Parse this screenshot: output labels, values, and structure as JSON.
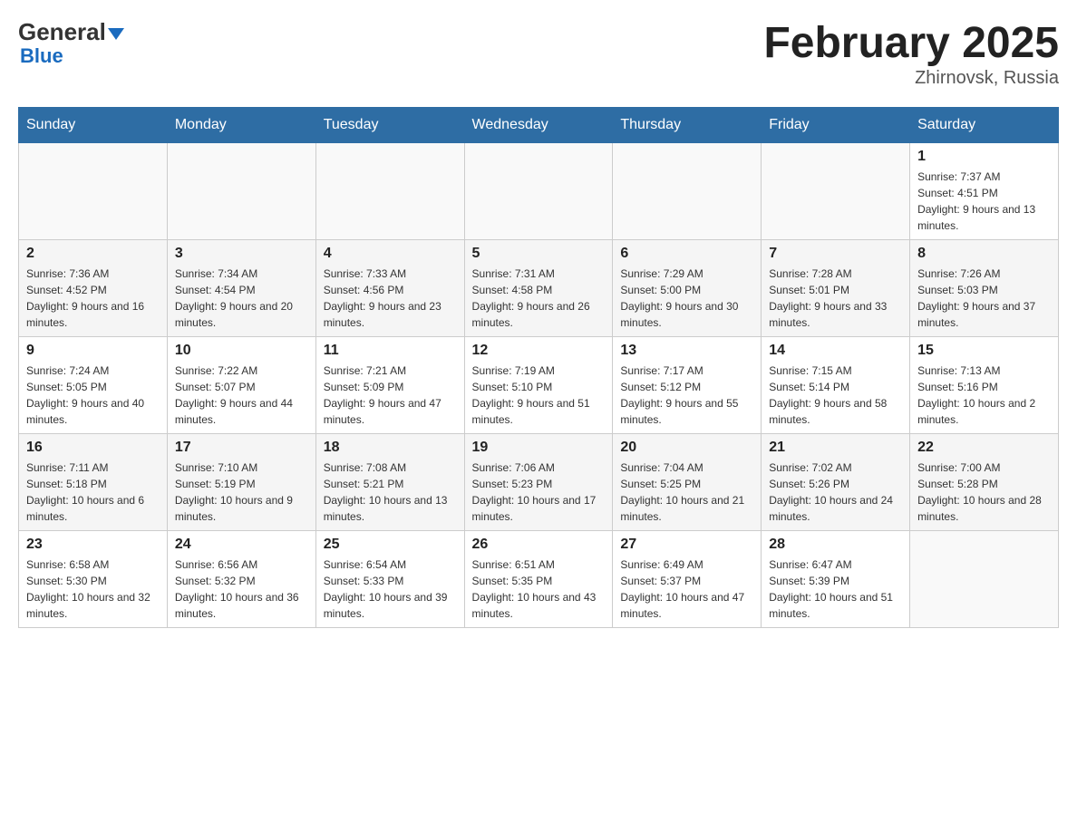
{
  "header": {
    "logo_text": "General",
    "logo_blue": "Blue",
    "month_title": "February 2025",
    "location": "Zhirnovsk, Russia"
  },
  "weekdays": [
    "Sunday",
    "Monday",
    "Tuesday",
    "Wednesday",
    "Thursday",
    "Friday",
    "Saturday"
  ],
  "weeks": [
    [
      {
        "day": "",
        "sunrise": "",
        "sunset": "",
        "daylight": ""
      },
      {
        "day": "",
        "sunrise": "",
        "sunset": "",
        "daylight": ""
      },
      {
        "day": "",
        "sunrise": "",
        "sunset": "",
        "daylight": ""
      },
      {
        "day": "",
        "sunrise": "",
        "sunset": "",
        "daylight": ""
      },
      {
        "day": "",
        "sunrise": "",
        "sunset": "",
        "daylight": ""
      },
      {
        "day": "",
        "sunrise": "",
        "sunset": "",
        "daylight": ""
      },
      {
        "day": "1",
        "sunrise": "Sunrise: 7:37 AM",
        "sunset": "Sunset: 4:51 PM",
        "daylight": "Daylight: 9 hours and 13 minutes."
      }
    ],
    [
      {
        "day": "2",
        "sunrise": "Sunrise: 7:36 AM",
        "sunset": "Sunset: 4:52 PM",
        "daylight": "Daylight: 9 hours and 16 minutes."
      },
      {
        "day": "3",
        "sunrise": "Sunrise: 7:34 AM",
        "sunset": "Sunset: 4:54 PM",
        "daylight": "Daylight: 9 hours and 20 minutes."
      },
      {
        "day": "4",
        "sunrise": "Sunrise: 7:33 AM",
        "sunset": "Sunset: 4:56 PM",
        "daylight": "Daylight: 9 hours and 23 minutes."
      },
      {
        "day": "5",
        "sunrise": "Sunrise: 7:31 AM",
        "sunset": "Sunset: 4:58 PM",
        "daylight": "Daylight: 9 hours and 26 minutes."
      },
      {
        "day": "6",
        "sunrise": "Sunrise: 7:29 AM",
        "sunset": "Sunset: 5:00 PM",
        "daylight": "Daylight: 9 hours and 30 minutes."
      },
      {
        "day": "7",
        "sunrise": "Sunrise: 7:28 AM",
        "sunset": "Sunset: 5:01 PM",
        "daylight": "Daylight: 9 hours and 33 minutes."
      },
      {
        "day": "8",
        "sunrise": "Sunrise: 7:26 AM",
        "sunset": "Sunset: 5:03 PM",
        "daylight": "Daylight: 9 hours and 37 minutes."
      }
    ],
    [
      {
        "day": "9",
        "sunrise": "Sunrise: 7:24 AM",
        "sunset": "Sunset: 5:05 PM",
        "daylight": "Daylight: 9 hours and 40 minutes."
      },
      {
        "day": "10",
        "sunrise": "Sunrise: 7:22 AM",
        "sunset": "Sunset: 5:07 PM",
        "daylight": "Daylight: 9 hours and 44 minutes."
      },
      {
        "day": "11",
        "sunrise": "Sunrise: 7:21 AM",
        "sunset": "Sunset: 5:09 PM",
        "daylight": "Daylight: 9 hours and 47 minutes."
      },
      {
        "day": "12",
        "sunrise": "Sunrise: 7:19 AM",
        "sunset": "Sunset: 5:10 PM",
        "daylight": "Daylight: 9 hours and 51 minutes."
      },
      {
        "day": "13",
        "sunrise": "Sunrise: 7:17 AM",
        "sunset": "Sunset: 5:12 PM",
        "daylight": "Daylight: 9 hours and 55 minutes."
      },
      {
        "day": "14",
        "sunrise": "Sunrise: 7:15 AM",
        "sunset": "Sunset: 5:14 PM",
        "daylight": "Daylight: 9 hours and 58 minutes."
      },
      {
        "day": "15",
        "sunrise": "Sunrise: 7:13 AM",
        "sunset": "Sunset: 5:16 PM",
        "daylight": "Daylight: 10 hours and 2 minutes."
      }
    ],
    [
      {
        "day": "16",
        "sunrise": "Sunrise: 7:11 AM",
        "sunset": "Sunset: 5:18 PM",
        "daylight": "Daylight: 10 hours and 6 minutes."
      },
      {
        "day": "17",
        "sunrise": "Sunrise: 7:10 AM",
        "sunset": "Sunset: 5:19 PM",
        "daylight": "Daylight: 10 hours and 9 minutes."
      },
      {
        "day": "18",
        "sunrise": "Sunrise: 7:08 AM",
        "sunset": "Sunset: 5:21 PM",
        "daylight": "Daylight: 10 hours and 13 minutes."
      },
      {
        "day": "19",
        "sunrise": "Sunrise: 7:06 AM",
        "sunset": "Sunset: 5:23 PM",
        "daylight": "Daylight: 10 hours and 17 minutes."
      },
      {
        "day": "20",
        "sunrise": "Sunrise: 7:04 AM",
        "sunset": "Sunset: 5:25 PM",
        "daylight": "Daylight: 10 hours and 21 minutes."
      },
      {
        "day": "21",
        "sunrise": "Sunrise: 7:02 AM",
        "sunset": "Sunset: 5:26 PM",
        "daylight": "Daylight: 10 hours and 24 minutes."
      },
      {
        "day": "22",
        "sunrise": "Sunrise: 7:00 AM",
        "sunset": "Sunset: 5:28 PM",
        "daylight": "Daylight: 10 hours and 28 minutes."
      }
    ],
    [
      {
        "day": "23",
        "sunrise": "Sunrise: 6:58 AM",
        "sunset": "Sunset: 5:30 PM",
        "daylight": "Daylight: 10 hours and 32 minutes."
      },
      {
        "day": "24",
        "sunrise": "Sunrise: 6:56 AM",
        "sunset": "Sunset: 5:32 PM",
        "daylight": "Daylight: 10 hours and 36 minutes."
      },
      {
        "day": "25",
        "sunrise": "Sunrise: 6:54 AM",
        "sunset": "Sunset: 5:33 PM",
        "daylight": "Daylight: 10 hours and 39 minutes."
      },
      {
        "day": "26",
        "sunrise": "Sunrise: 6:51 AM",
        "sunset": "Sunset: 5:35 PM",
        "daylight": "Daylight: 10 hours and 43 minutes."
      },
      {
        "day": "27",
        "sunrise": "Sunrise: 6:49 AM",
        "sunset": "Sunset: 5:37 PM",
        "daylight": "Daylight: 10 hours and 47 minutes."
      },
      {
        "day": "28",
        "sunrise": "Sunrise: 6:47 AM",
        "sunset": "Sunset: 5:39 PM",
        "daylight": "Daylight: 10 hours and 51 minutes."
      },
      {
        "day": "",
        "sunrise": "",
        "sunset": "",
        "daylight": ""
      }
    ]
  ]
}
